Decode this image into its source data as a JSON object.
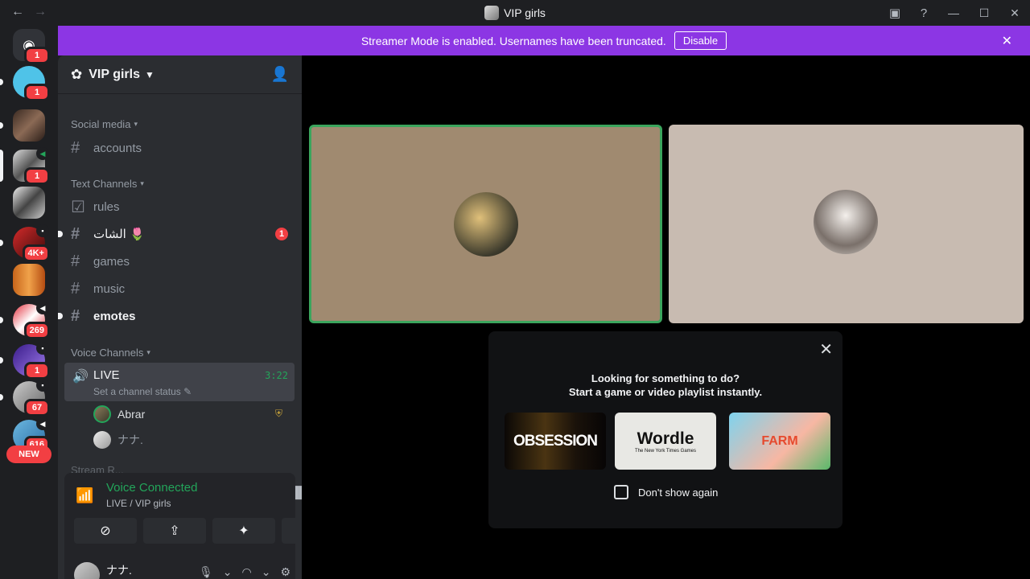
{
  "window": {
    "title": "VIP girls",
    "back": "←",
    "forward": "→"
  },
  "banner": {
    "text": "Streamer Mode is enabled. Usernames have been truncated.",
    "button": "Disable"
  },
  "rail": {
    "badges": [
      "1",
      "1",
      "1",
      "4K+",
      "269",
      "1",
      "67",
      "616"
    ],
    "new_label": "NEW"
  },
  "guild": {
    "name": "VIP girls"
  },
  "categories": {
    "social": "Social media",
    "text": "Text Channels",
    "voice": "Voice Channels",
    "partial": "Stream R..."
  },
  "channels": [
    {
      "name": "accounts"
    },
    {
      "name": "rules"
    },
    {
      "name": "الشات 🌷",
      "badge": "1"
    },
    {
      "name": "games"
    },
    {
      "name": "music"
    },
    {
      "name": "emotes"
    }
  ],
  "voice_channel": {
    "name": "LIVE",
    "time": "3:22",
    "status": "Set a channel status"
  },
  "members": [
    {
      "name": "Abrar"
    },
    {
      "name": "ナナ."
    }
  ],
  "voice_panel": {
    "title": "Voice Connected",
    "subtitle": "LIVE / VIP girls"
  },
  "user": {
    "name": "ナナ."
  },
  "activity": {
    "line1": "Looking for something to do?",
    "line2": "Start a game or video playlist instantly.",
    "games": [
      {
        "label": "OBSESSION"
      },
      {
        "label": "Wordle",
        "sub": "The New York Times Games"
      },
      {
        "label": "FARM"
      }
    ],
    "checkbox": "Don't show again"
  },
  "colors": {
    "accent": "#8c36e4",
    "speaking": "#3ba55d",
    "badge": "#f23f43"
  }
}
